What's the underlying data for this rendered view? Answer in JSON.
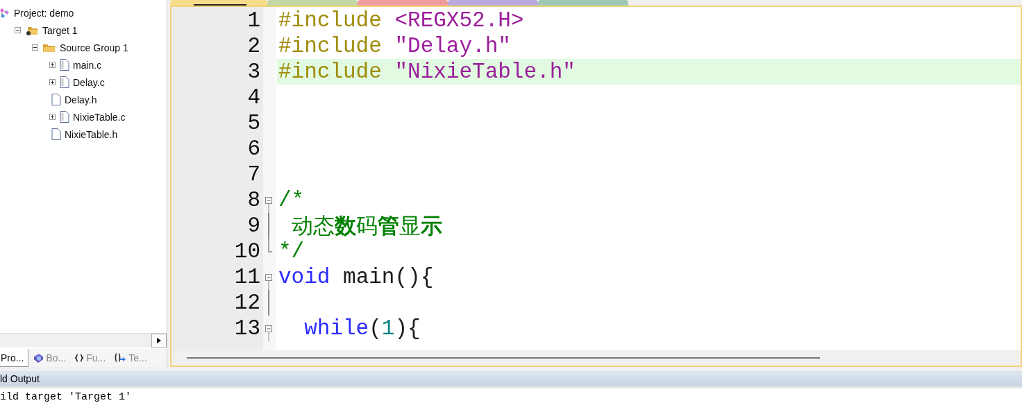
{
  "project_tree": [
    {
      "label": "Project: demo",
      "kind": "project",
      "children": [
        {
          "label": "Target 1",
          "kind": "target",
          "expanded": true,
          "children": [
            {
              "label": "Source Group 1",
              "kind": "group",
              "expanded": true,
              "children": [
                {
                  "label": "main.c",
                  "kind": "source",
                  "expanded": false
                },
                {
                  "label": "Delay.c",
                  "kind": "source",
                  "expanded": false
                },
                {
                  "label": "Delay.h",
                  "kind": "header"
                },
                {
                  "label": "NixieTable.c",
                  "kind": "source",
                  "expanded": false
                },
                {
                  "label": "NixieTable.h",
                  "kind": "header"
                }
              ]
            }
          ]
        }
      ]
    }
  ],
  "panel_tabs": [
    {
      "label": "Pro...",
      "kind": "project",
      "selected": true
    },
    {
      "label": "Bo...",
      "kind": "books",
      "selected": false
    },
    {
      "label": "Fu...",
      "kind": "functions",
      "selected": false
    },
    {
      "label": "Te...",
      "kind": "templates",
      "selected": false
    }
  ],
  "editor_tabs": [
    {
      "selected": true,
      "color": "#f7dc8c"
    },
    {
      "selected": false,
      "color": "#c4d6a4"
    },
    {
      "selected": false,
      "color": "#ee9c9c"
    },
    {
      "selected": false,
      "color": "#b9a9dd"
    },
    {
      "selected": false,
      "color": "#9cc8b4"
    }
  ],
  "code_lines": [
    {
      "number": "1",
      "kind": "plain",
      "highlighted": false,
      "tokens": [
        {
          "kind": "preproc",
          "text": "#include"
        },
        {
          "kind": "string",
          "text": " <REGX52.H>"
        }
      ]
    },
    {
      "number": "2",
      "kind": "plain",
      "highlighted": false,
      "tokens": [
        {
          "kind": "preproc",
          "text": "#include"
        },
        {
          "kind": "string",
          "text": " \"Delay.h\""
        }
      ]
    },
    {
      "number": "3",
      "kind": "plain",
      "highlighted": true,
      "tokens": [
        {
          "kind": "preproc",
          "text": "#include"
        },
        {
          "kind": "string",
          "text": " \"NixieTable.h\""
        }
      ]
    },
    {
      "number": "4",
      "kind": "plain",
      "highlighted": false
    },
    {
      "number": "5",
      "kind": "plain",
      "highlighted": false
    },
    {
      "number": "6",
      "kind": "plain",
      "highlighted": false
    },
    {
      "number": "7",
      "kind": "plain",
      "highlighted": false
    },
    {
      "number": "8",
      "kind": "opener",
      "highlighted": false,
      "tokens": [
        {
          "kind": "comment",
          "text": "/*"
        }
      ]
    },
    {
      "number": "9",
      "kind": "body",
      "highlighted": false,
      "tokens": [
        {
          "kind": "comment",
          "text": " 动态**数**码**管**显**示**"
        }
      ]
    },
    {
      "number": "10",
      "kind": "closer",
      "highlighted": false,
      "tokens": [
        {
          "kind": "comment",
          "text": "*/"
        }
      ]
    },
    {
      "number": "11",
      "kind": "opener",
      "highlighted": false,
      "tokens": [
        {
          "kind": "keyword",
          "text": "void"
        },
        {
          "kind": "plain",
          "text": " main(){"
        }
      ]
    },
    {
      "number": "12",
      "kind": "body",
      "highlighted": false
    },
    {
      "number": "13",
      "kind": "opener",
      "highlighted": false,
      "tokens": [
        {
          "kind": "keyword",
          "text": "  while"
        },
        {
          "kind": "plain",
          "text": "("
        },
        {
          "kind": "number",
          "text": "1"
        },
        {
          "kind": "plain",
          "text": "){"
        }
      ]
    }
  ],
  "output": {
    "title": "ld Output",
    "lines": [
      "ild target 'Target 1'"
    ]
  }
}
